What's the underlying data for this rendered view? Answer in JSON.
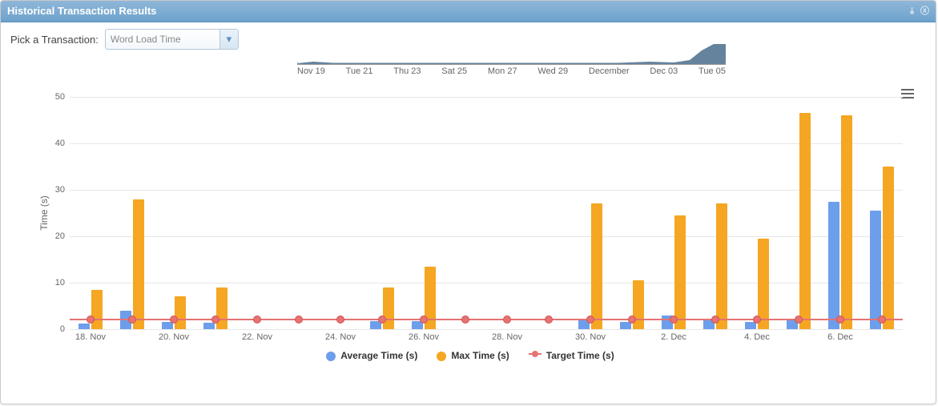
{
  "panel": {
    "title": "Historical Transaction Results"
  },
  "toolbar": {
    "picker_label": "Pick a Transaction:",
    "picker_value": "Word Load Time"
  },
  "navigator": {
    "ticks": [
      "Nov 19",
      "Tue 21",
      "Thu 23",
      "Sat 25",
      "Mon 27",
      "Wed 29",
      "December",
      "Dec 03",
      "Tue 05"
    ]
  },
  "legend": {
    "avg": "Average Time (s)",
    "max": "Max Time (s)",
    "target": "Target Time (s)"
  },
  "chart": {
    "ylabel": "Time (s)",
    "ymax": 50,
    "yticks": [
      0,
      10,
      20,
      30,
      40,
      50
    ],
    "target": 2,
    "xlabels": [
      "18. Nov",
      "20. Nov",
      "22. Nov",
      "24. Nov",
      "26. Nov",
      "28. Nov",
      "30. Nov",
      "2. Dec",
      "4. Dec",
      "6. Dec"
    ]
  },
  "chart_data": {
    "type": "bar",
    "title": "Historical Transaction Results",
    "ylabel": "Time (s)",
    "ylim": [
      0,
      50
    ],
    "xlabel": "",
    "categories": [
      "18. Nov",
      "19. Nov",
      "20. Nov",
      "21. Nov",
      "22. Nov",
      "23. Nov",
      "24. Nov",
      "25. Nov",
      "26. Nov",
      "27. Nov",
      "28. Nov",
      "29. Nov",
      "30. Nov",
      "1. Dec",
      "2. Dec",
      "3. Dec",
      "4. Dec",
      "5. Dec",
      "6. Dec",
      "7. Dec"
    ],
    "series": [
      {
        "name": "Average Time (s)",
        "color": "#6d9eeb",
        "values": [
          1.2,
          4.0,
          1.5,
          1.3,
          null,
          null,
          null,
          1.8,
          1.8,
          null,
          null,
          null,
          2.2,
          1.5,
          3.0,
          2.2,
          1.5,
          2.2,
          27.5,
          25.5
        ]
      },
      {
        "name": "Max Time (s)",
        "color": "#f5a623",
        "values": [
          8.5,
          28.0,
          7.0,
          9.0,
          null,
          null,
          null,
          9.0,
          13.5,
          null,
          null,
          null,
          27.0,
          10.5,
          24.5,
          27.0,
          19.5,
          46.5,
          46.0,
          35.0
        ]
      },
      {
        "name": "Target Time (s)",
        "color": "#e57373",
        "type": "line",
        "values": [
          2,
          2,
          2,
          2,
          2,
          2,
          2,
          2,
          2,
          2,
          2,
          2,
          2,
          2,
          2,
          2,
          2,
          2,
          2,
          2
        ]
      }
    ],
    "legend_position": "bottom",
    "grid": true
  }
}
